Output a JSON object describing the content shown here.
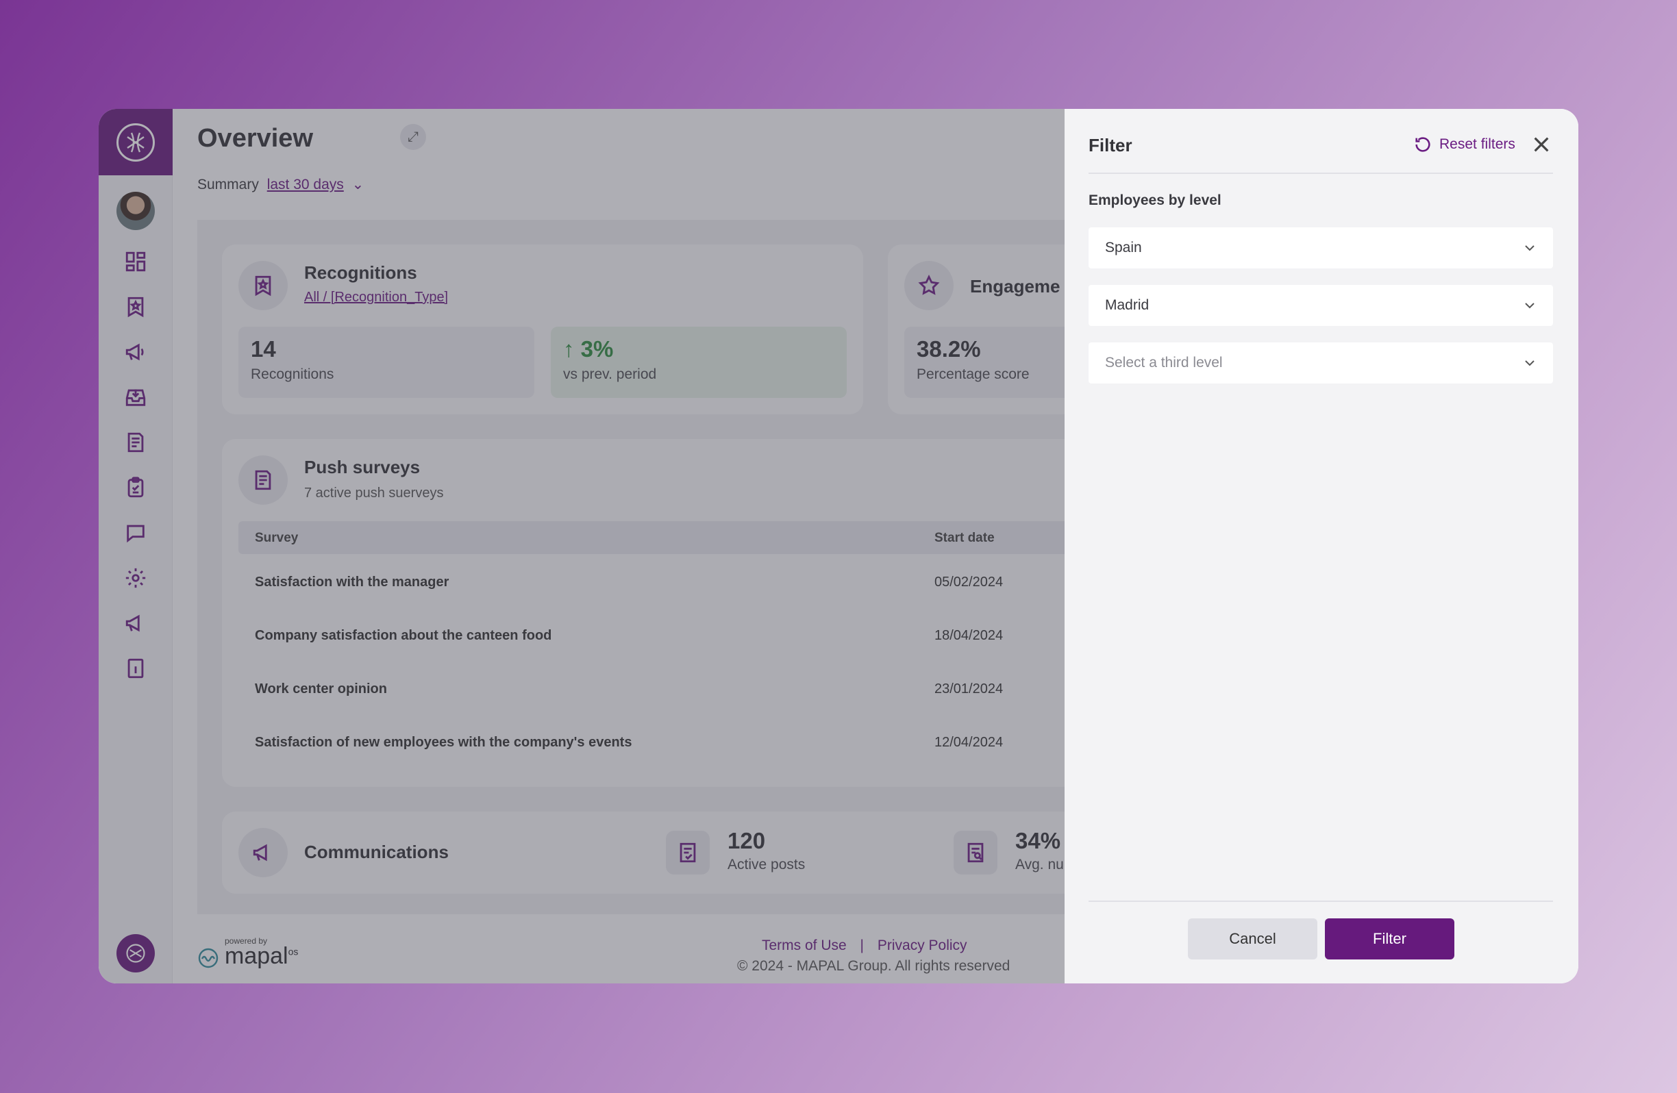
{
  "sidebar": {
    "logo": "mapal-logo-icon",
    "icons": [
      "dashboard-icon",
      "bookmark-star-icon",
      "megaphone-icon",
      "inbox-download-icon",
      "document-icon",
      "clipboard-check-icon",
      "chat-bubble-icon",
      "gear-icon",
      "announcement-icon",
      "info-book-icon"
    ]
  },
  "header": {
    "title": "Overview",
    "summary_label": "Summary",
    "summary_period": "last 30 days"
  },
  "recognitions": {
    "title": "Recognitions",
    "filter_link": "All / [Recognition_Type]",
    "count": "14",
    "count_label": "Recognitions",
    "change": "↑ 3%",
    "change_label": "vs prev. period"
  },
  "engagement": {
    "title": "Engageme",
    "score": "38.2%",
    "score_label": "Percentage score"
  },
  "push_surveys": {
    "title": "Push surveys",
    "subtitle": "7 active push suerveys",
    "columns": [
      "Survey",
      "Start date"
    ],
    "rows": [
      {
        "survey": "Satisfaction with the manager",
        "date": "05/02/2024"
      },
      {
        "survey": "Company satisfaction about the canteen food",
        "date": "18/04/2024"
      },
      {
        "survey": "Work center opinion",
        "date": "23/01/2024"
      },
      {
        "survey": "Satisfaction of new employees with the company's events",
        "date": "12/04/2024"
      }
    ]
  },
  "communications": {
    "title": "Communications",
    "active_posts": "120",
    "active_posts_label": "Active posts",
    "avg_value": "34%",
    "avg_label": "Avg. nu"
  },
  "footer": {
    "powered_by": "powered by",
    "brand": "mapal",
    "brand_suffix": "os",
    "terms": "Terms of Use",
    "separator": "|",
    "privacy": "Privacy Policy",
    "copyright": "© 2024 - MAPAL Group. All rights reserved"
  },
  "filter_panel": {
    "title": "Filter",
    "reset_label": "Reset filters",
    "section_label": "Employees by level",
    "level1": "Spain",
    "level2": "Madrid",
    "level3_placeholder": "Select a third level",
    "cancel_label": "Cancel",
    "filter_label": "Filter"
  },
  "colors": {
    "brand": "#661a7d",
    "positive": "#2e8a3e"
  }
}
